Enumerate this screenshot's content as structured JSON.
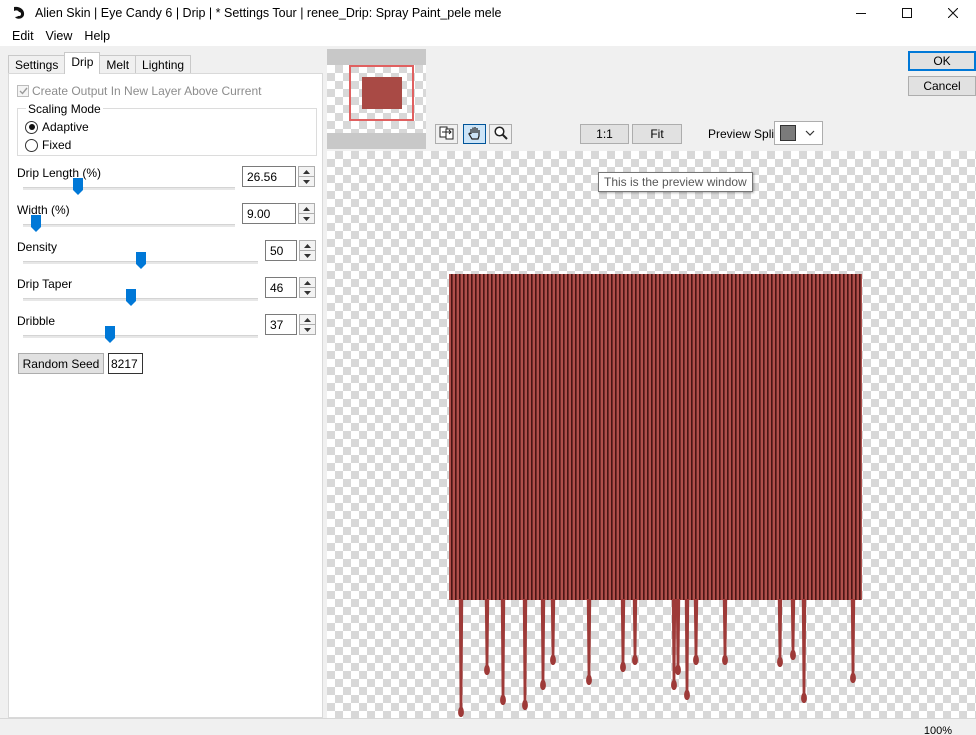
{
  "window": {
    "title": "Alien Skin | Eye Candy 6 | Drip | * Settings Tour | renee_Drip: Spray Paint_pele mele"
  },
  "menu": [
    "Edit",
    "View",
    "Help"
  ],
  "tabs": [
    {
      "label": "Settings",
      "active": false
    },
    {
      "label": "Drip",
      "active": true
    },
    {
      "label": "Melt",
      "active": false
    },
    {
      "label": "Lighting",
      "active": false
    }
  ],
  "create_output": {
    "label": "Create Output In New Layer Above Current",
    "checked": true,
    "disabled": true
  },
  "scaling_mode": {
    "title": "Scaling Mode",
    "options": [
      {
        "label": "Adaptive",
        "selected": true
      },
      {
        "label": "Fixed",
        "selected": false
      }
    ]
  },
  "params": [
    {
      "label": "Drip Length (%)",
      "value": "26.56",
      "fraction": 0.26
    },
    {
      "label": "Width (%)",
      "value": "9.00",
      "fraction": 0.06
    },
    {
      "label": "Density",
      "value": "50",
      "fraction": 0.5
    },
    {
      "label": "Drip Taper",
      "value": "46",
      "fraction": 0.46
    },
    {
      "label": "Dribble",
      "value": "37",
      "fraction": 0.37
    }
  ],
  "random_seed": {
    "button_label": "Random Seed",
    "value": "8217"
  },
  "dialog_buttons": {
    "ok": "OK",
    "cancel": "Cancel"
  },
  "preview_toolbar": {
    "zoom_1_1": "1:1",
    "fit": "Fit",
    "preview_split_label": "Preview Split:",
    "tools": [
      "compare-icon",
      "hand-icon",
      "zoom-icon"
    ]
  },
  "preview": {
    "tooltip": "This is the preview window",
    "paint_color": "#a0413f"
  },
  "status": {
    "zoom": "100%"
  },
  "colors": {
    "accent": "#0078d7",
    "swatch": "#7b7b7b"
  }
}
